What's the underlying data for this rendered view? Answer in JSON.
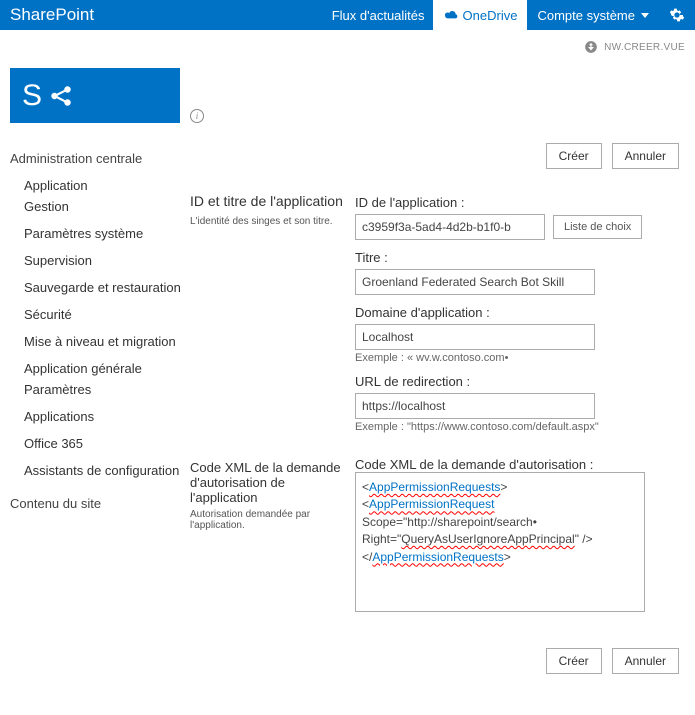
{
  "topbar": {
    "brand": "SharePoint",
    "newsfeed_label": "Flux d'actualités",
    "onedrive_label": "OneDrive",
    "account_label": "Compte système",
    "share_label": "NW.CREER.VUE"
  },
  "nav": {
    "header": "Administration centrale",
    "items": [
      "Application",
      "Gestion",
      "Paramètres système",
      "Supervision",
      "Sauvegarde et restauration",
      "Sécurité",
      "Mise à niveau et migration",
      "Application générale",
      "Paramètres",
      "Applications",
      "Office 365",
      "Assistants de configuration"
    ],
    "footer": "Contenu du site"
  },
  "actions": {
    "create": "Créer",
    "cancel": "Annuler"
  },
  "section_id": {
    "title": "ID et titre de l'application",
    "desc": "L'identité des singes et son titre."
  },
  "section_perm": {
    "title": "Code XML de la demande d'autorisation de l'application",
    "desc": "Autorisation demandée par l'application."
  },
  "form": {
    "appid_label": "ID de l'application :",
    "appid_value": "c3959f3a-5ad4-4d2b-b1f0-b",
    "lookup_label": "Liste de choix",
    "title_label": "Titre :",
    "title_value": "Groenland Federated Search Bot Skill",
    "domain_label": "Domaine d'application :",
    "domain_value": "Localhost",
    "domain_example": "Exemple : « wv.w.contoso.com•",
    "redirect_label": "URL de redirection :",
    "redirect_value": "https://localhost",
    "redirect_example": "Exemple : \"https://www.contoso.com/default.aspx\"",
    "xml_label": "Code XML de la demande d'autorisation :",
    "xml_parts": {
      "l1": "AppPermissionRequests",
      "l2": "AppPermissionRequest",
      "l3a": "Scope=\"http://sharepoint/search•",
      "l3b": "Right=\"",
      "l3c": "QueryAsUserIgnoreAppPrincipal",
      "l3d": "\" />",
      "l4": "AppPermissionRequests"
    }
  }
}
